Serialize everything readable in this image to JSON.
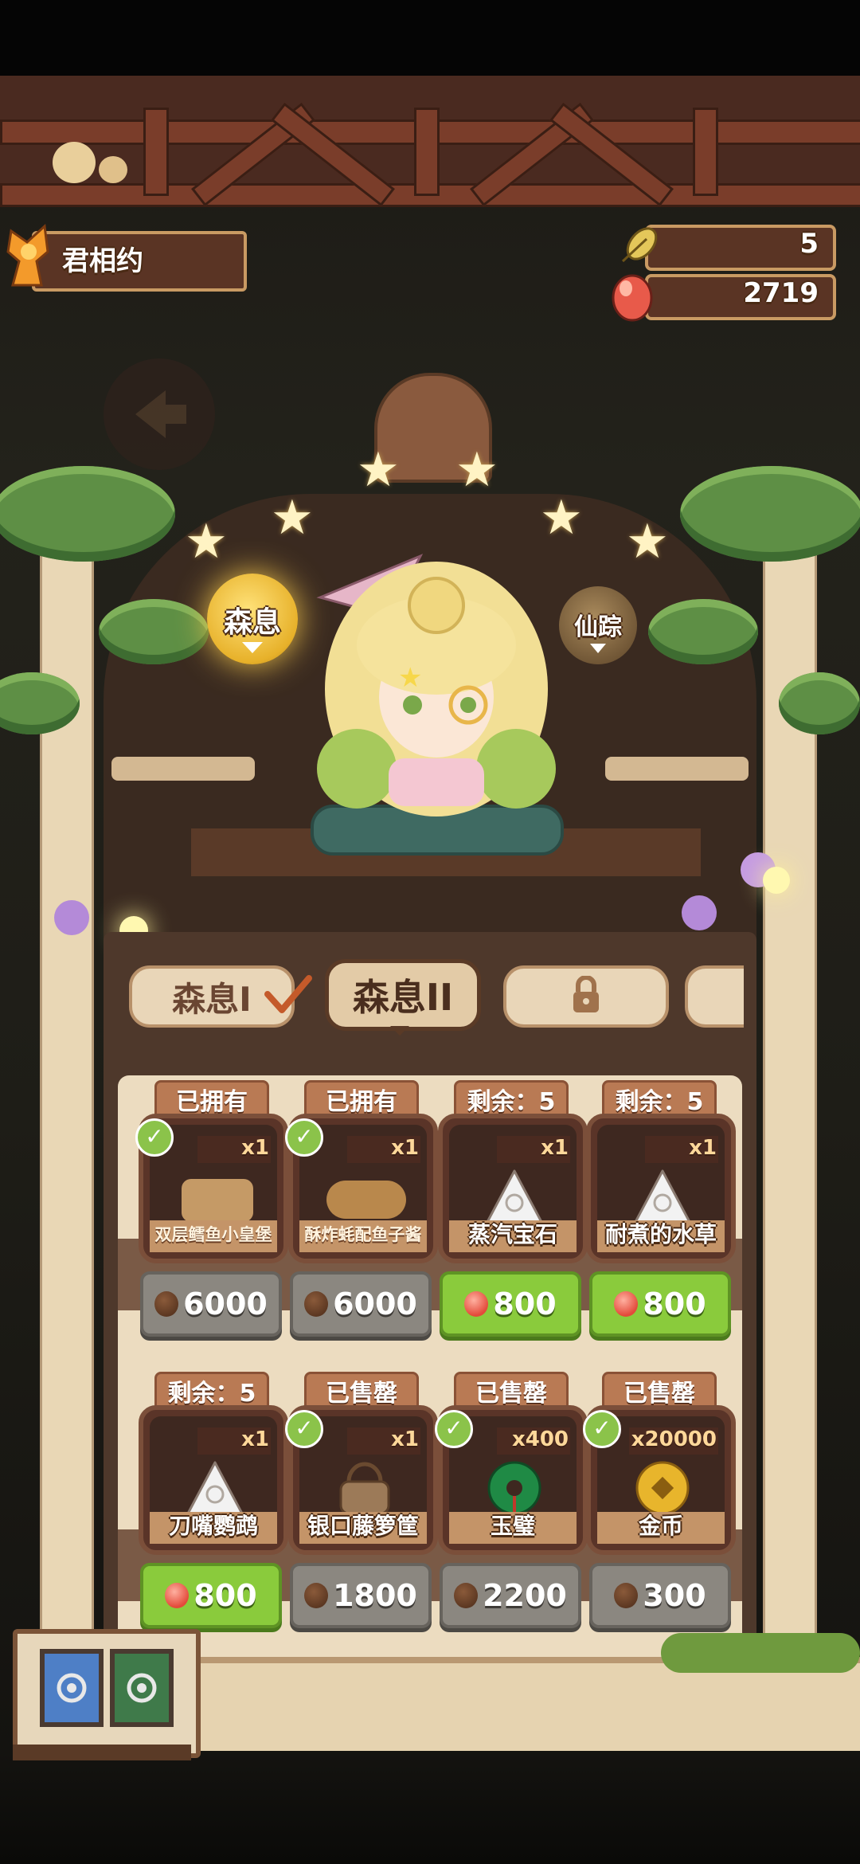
{
  "player": {
    "name": "君相约"
  },
  "resources": [
    {
      "icon": "leaf-icon",
      "value": "5"
    },
    {
      "icon": "egg-icon",
      "value": "2719"
    }
  ],
  "lanterns": [
    {
      "label": "森息",
      "active": true
    },
    {
      "label": "仙踪",
      "active": false
    }
  ],
  "tabs": [
    {
      "label": "森息I",
      "state": "completed"
    },
    {
      "label": "森息II",
      "state": "selected"
    },
    {
      "label": "",
      "state": "locked"
    }
  ],
  "items": [
    {
      "status": "已拥有",
      "owned": true,
      "qty": "x1",
      "name": "双层鳕鱼小皇堡",
      "price": "6000",
      "currency": "dark",
      "button": "gray",
      "art": "burger"
    },
    {
      "status": "已拥有",
      "owned": true,
      "qty": "x1",
      "name": "酥炸蚝配鱼子酱",
      "price": "6000",
      "currency": "dark",
      "button": "gray",
      "art": "food"
    },
    {
      "status": "剩余：5",
      "owned": false,
      "qty": "x1",
      "name": "蒸汽宝石",
      "price": "800",
      "currency": "red",
      "button": "green",
      "art": "rice"
    },
    {
      "status": "剩余：5",
      "owned": false,
      "qty": "x1",
      "name": "耐煮的水草",
      "price": "800",
      "currency": "red",
      "button": "green",
      "art": "rice"
    },
    {
      "status": "剩余：5",
      "owned": false,
      "qty": "x1",
      "name": "刀嘴鹦鹉",
      "price": "800",
      "currency": "red",
      "button": "green",
      "art": "rice"
    },
    {
      "status": "已售罄",
      "owned": true,
      "qty": "x1",
      "name": "银口藤箩筐",
      "price": "1800",
      "currency": "dark",
      "button": "gray",
      "art": "basket"
    },
    {
      "status": "已售罄",
      "owned": true,
      "qty": "x400",
      "name": "玉璧",
      "price": "2200",
      "currency": "dark",
      "button": "gray",
      "art": "jade"
    },
    {
      "status": "已售罄",
      "owned": true,
      "qty": "x20000",
      "name": "金币",
      "price": "300",
      "currency": "dark",
      "button": "gray",
      "art": "coin"
    }
  ],
  "colors": {
    "green_button": "#8acb3c",
    "gray_button": "#8b8780",
    "accent_gold": "#e7b12a"
  }
}
